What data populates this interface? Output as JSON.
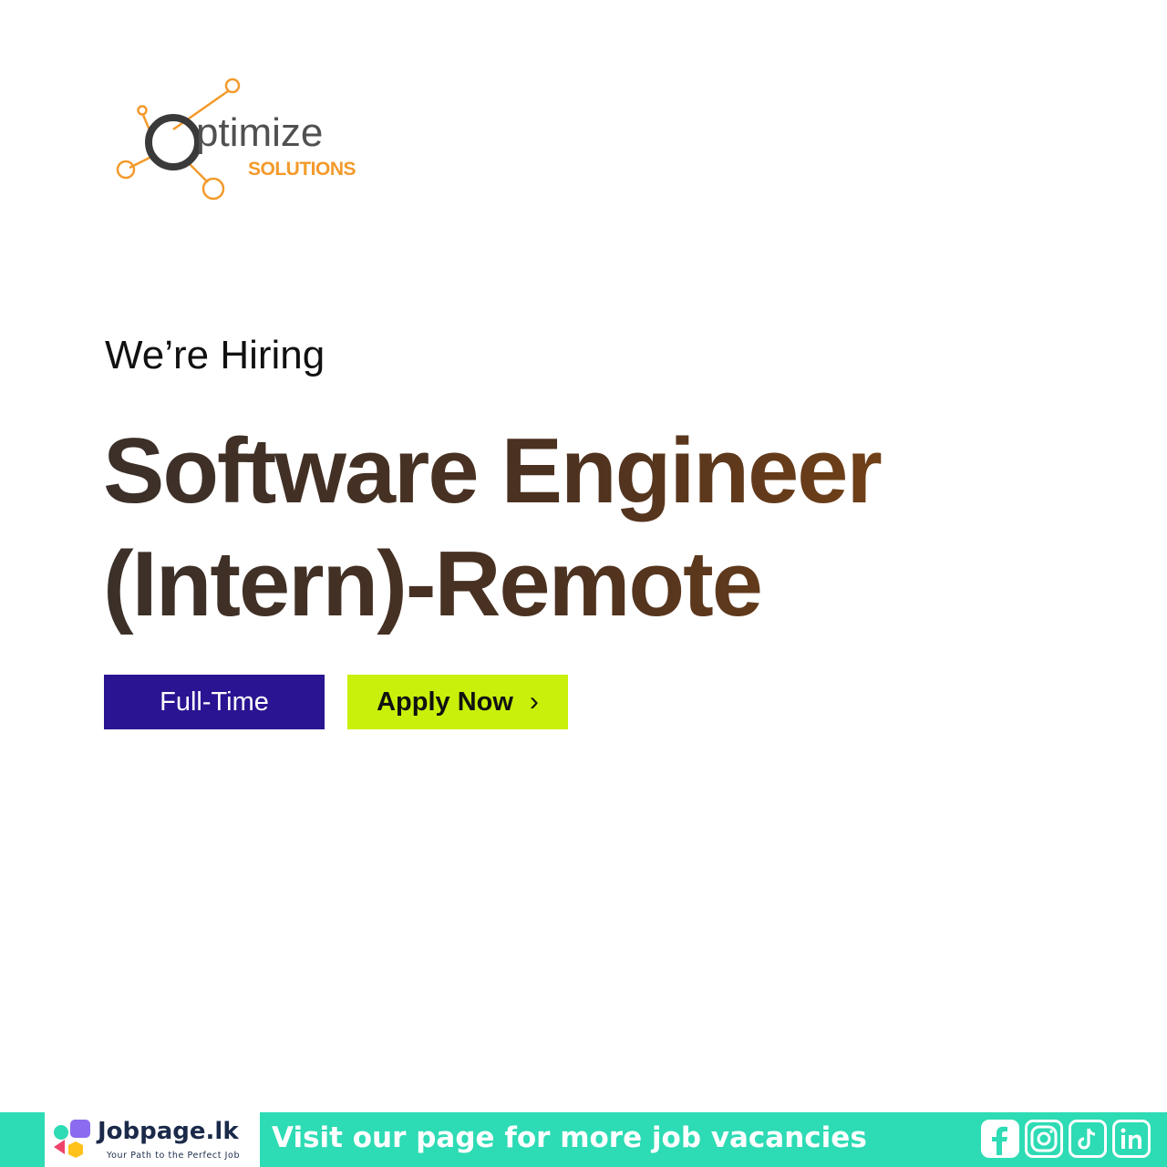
{
  "logo": {
    "word_o": "O",
    "word_rest": "ptimize",
    "sub": "SOLUTIONS",
    "colors": {
      "accent": "#F39A2B",
      "ring": "#3a3a3a"
    }
  },
  "hiring_label": "We’re Hiring",
  "job_title": {
    "line1": "Software Engineer",
    "line2": "(Intern)-Remote"
  },
  "badges": {
    "employment_type": "Full-Time",
    "apply_label": "Apply Now",
    "apply_icon": "chevron-right-icon"
  },
  "footer": {
    "brand_name": "Jobpage.lk",
    "brand_tagline": "Your Path to the Perfect Job",
    "cta_text": "Visit our page for more job vacancies",
    "social_icons": [
      "facebook-icon",
      "instagram-icon",
      "tiktok-icon",
      "linkedin-icon"
    ],
    "colors": {
      "bar": "#2ddbb4",
      "brand_text": "#1b2a4a"
    }
  },
  "colors": {
    "full_time_bg": "#2a1492",
    "apply_bg": "#c8f00a",
    "title_start": "#3b3029",
    "title_end": "#8a4a12"
  }
}
